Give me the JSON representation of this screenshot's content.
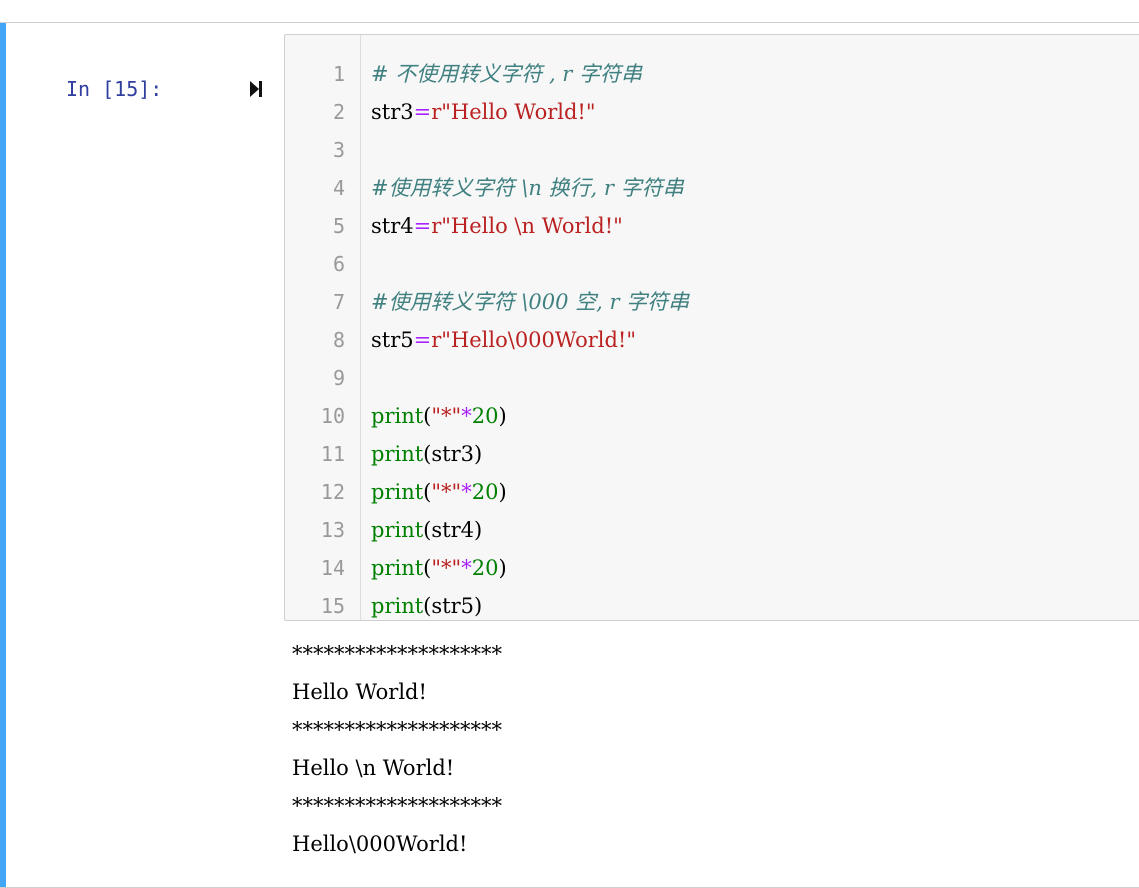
{
  "cell": {
    "prompt": "In [15]:",
    "run_icon": "run-cell-icon",
    "line_numbers": [
      "1",
      "2",
      "3",
      "4",
      "5",
      "6",
      "7",
      "8",
      "9",
      "10",
      "11",
      "12",
      "13",
      "14",
      "15"
    ],
    "code_lines": [
      [
        {
          "t": "comment",
          "v": "# 不使用转义字符 , r 字符串"
        }
      ],
      [
        {
          "t": "name",
          "v": "str3"
        },
        {
          "t": "op",
          "v": "="
        },
        {
          "t": "string",
          "v": "r\"Hello World!\""
        }
      ],
      [],
      [
        {
          "t": "comment",
          "v": "#使用转义字符 \\n 换行, r 字符串"
        }
      ],
      [
        {
          "t": "name",
          "v": "str4"
        },
        {
          "t": "op",
          "v": "="
        },
        {
          "t": "string",
          "v": "r\"Hello \\n World!\""
        }
      ],
      [],
      [
        {
          "t": "comment",
          "v": "#使用转义字符 \\000 空, r 字符串"
        }
      ],
      [
        {
          "t": "name",
          "v": "str5"
        },
        {
          "t": "op",
          "v": "="
        },
        {
          "t": "string",
          "v": "r\"Hello\\000World!\""
        }
      ],
      [],
      [
        {
          "t": "builtin",
          "v": "print"
        },
        {
          "t": "name",
          "v": "("
        },
        {
          "t": "string",
          "v": "\"*\""
        },
        {
          "t": "op",
          "v": "*"
        },
        {
          "t": "number",
          "v": "20"
        },
        {
          "t": "name",
          "v": ")"
        }
      ],
      [
        {
          "t": "builtin",
          "v": "print"
        },
        {
          "t": "name",
          "v": "(str3)"
        }
      ],
      [
        {
          "t": "builtin",
          "v": "print"
        },
        {
          "t": "name",
          "v": "("
        },
        {
          "t": "string",
          "v": "\"*\""
        },
        {
          "t": "op",
          "v": "*"
        },
        {
          "t": "number",
          "v": "20"
        },
        {
          "t": "name",
          "v": ")"
        }
      ],
      [
        {
          "t": "builtin",
          "v": "print"
        },
        {
          "t": "name",
          "v": "(str4)"
        }
      ],
      [
        {
          "t": "builtin",
          "v": "print"
        },
        {
          "t": "name",
          "v": "("
        },
        {
          "t": "string",
          "v": "\"*\""
        },
        {
          "t": "op",
          "v": "*"
        },
        {
          "t": "number",
          "v": "20"
        },
        {
          "t": "name",
          "v": ")"
        }
      ],
      [
        {
          "t": "builtin",
          "v": "print"
        },
        {
          "t": "name",
          "v": "(str5)"
        }
      ]
    ],
    "output_lines": [
      "********************",
      "Hello World!",
      "********************",
      "Hello \\n World!",
      "********************",
      "Hello\\000World!"
    ]
  },
  "colors": {
    "selection_bar": "#42a5f5",
    "prompt": "#303f9f",
    "comment": "#408080",
    "operator": "#aa22ff",
    "string": "#ba2121",
    "builtin": "#008000",
    "editor_bg": "#f7f7f7"
  }
}
